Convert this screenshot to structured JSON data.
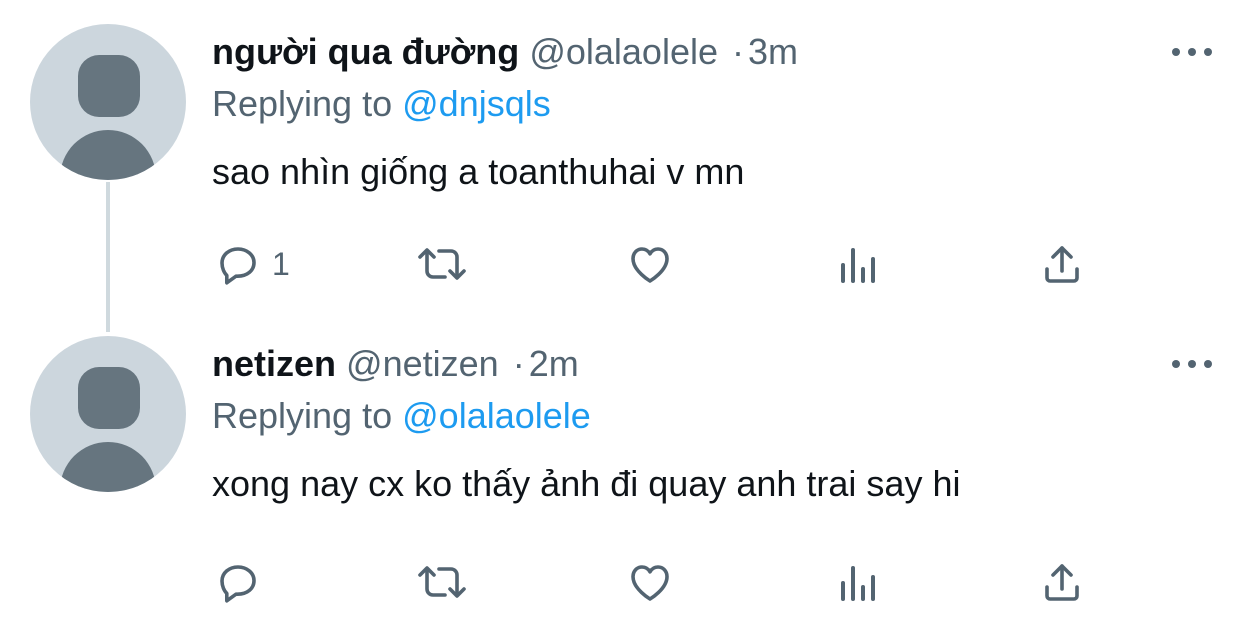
{
  "tweets": [
    {
      "name": "người qua đường",
      "handle": "@olalaolele",
      "separator": "·",
      "time": "3m",
      "replying_prefix": "Replying to",
      "replying_to": "@dnjsqls",
      "text": "sao nhìn giống a toanthuhai v mn",
      "reply_count": "1"
    },
    {
      "name": "netizen",
      "handle": "@netizen",
      "separator": "·",
      "time": "2m",
      "replying_prefix": "Replying to",
      "replying_to": "@olalaolele",
      "text": "xong nay cx ko thấy ảnh đi quay anh trai say hi",
      "reply_count": ""
    }
  ],
  "icons": {
    "reply": "reply-icon",
    "retweet": "retweet-icon",
    "like": "heart-icon",
    "views": "views-icon",
    "share": "share-icon",
    "more": "more-icon"
  },
  "colors": {
    "text": "#0f1419",
    "secondary": "#536471",
    "link": "#1d9bf0",
    "avatar_bg": "#ccd6dd",
    "avatar_fg": "#66757f",
    "thread_line": "#cfd9de"
  }
}
